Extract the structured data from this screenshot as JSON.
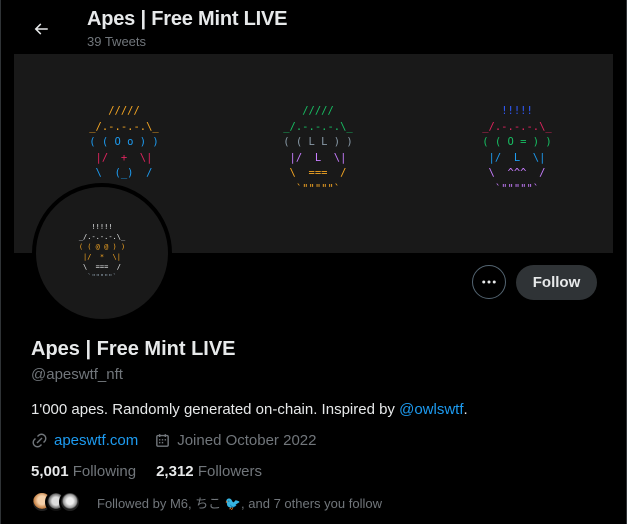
{
  "header": {
    "title": "Apes | Free Mint LIVE",
    "tweet_count": "39 Tweets"
  },
  "banner": {
    "apes": [
      {
        "lines": [
          "/////",
          "_/.-.-.-.\\_",
          "( ( O o ) )",
          "|/  +  \\|",
          "\\  (_)  /"
        ],
        "colors": [
          "#f5a623",
          "#f5a623",
          "#1d9bf0",
          "#e0245e",
          "#1d9bf0"
        ]
      },
      {
        "lines": [
          "/////",
          "_/.-.-.-.\\_",
          "( ( L L ) )",
          "|/  L  \\|",
          "\\  ===  /",
          "`\"\"\"\"\"`"
        ],
        "colors": [
          "#17bf63",
          "#17bf63",
          "#8899a6",
          "#c77dff",
          "#f5a623",
          "#f5a623"
        ]
      },
      {
        "lines": [
          "!!!!!",
          "_/.-.-.-.\\_",
          "( ( O = ) )",
          "|/  L  \\|",
          "\\  ^^^  /",
          "`\"\"\"\"\"`"
        ],
        "colors": [
          "#2f5bff",
          "#e0245e",
          "#17bf63",
          "#1d9bf0",
          "#c77dff",
          "#c77dff"
        ]
      }
    ]
  },
  "avatar": {
    "lines": [
      "!!!!!",
      "_/.-.-.-.\\_",
      "( ( @ @ ) )",
      "|/  *  \\|",
      "\\  ===  /",
      "`\"\"\"\"\"`"
    ],
    "colors": [
      "#e7e9ea",
      "#e7e9ea",
      "#f5a623",
      "#f5a623",
      "#e7e9ea",
      "#8899a6"
    ]
  },
  "actions": {
    "follow_label": "Follow"
  },
  "profile": {
    "display_name": "Apes | Free Mint LIVE",
    "handle": "@apeswtf_nft",
    "bio_text": "1'000 apes. Randomly generated on-chain. Inspired by ",
    "bio_mention": "@owlswtf",
    "bio_end": ".",
    "website": "apeswtf.com",
    "joined": "Joined October 2022",
    "following_count": "5,001",
    "following_label": "Following",
    "followers_count": "2,312",
    "followers_label": "Followers",
    "followed_by": "Followed by M6, ちこ 🐦, and 7 others you follow"
  },
  "colors": {
    "accent": "#1d9bf0",
    "muted": "#71767b",
    "banner_bg": "#191919"
  },
  "icons": [
    "back-arrow-icon",
    "more-horizontal-icon",
    "link-icon",
    "calendar-icon"
  ]
}
